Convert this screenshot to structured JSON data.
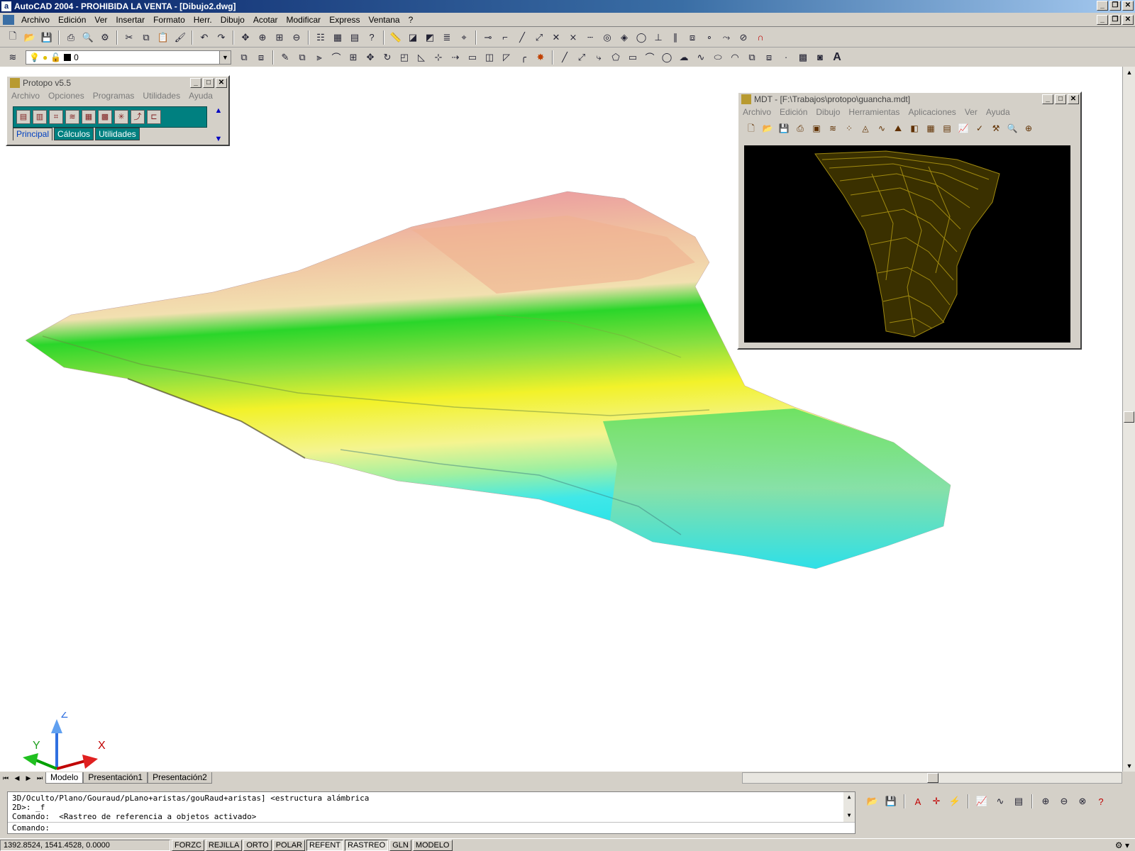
{
  "window": {
    "title": "AutoCAD 2004 - PROHIBIDA LA VENTA - [Dibujo2.dwg]",
    "app_icon": "a"
  },
  "menu": [
    "Archivo",
    "Edición",
    "Ver",
    "Insertar",
    "Formato",
    "Herr.",
    "Dibujo",
    "Acotar",
    "Modificar",
    "Express",
    "Ventana",
    "?"
  ],
  "layer": {
    "current": "0"
  },
  "text_tool": "A",
  "protopo": {
    "title": "Protopo v5.5",
    "menu": [
      "Archivo",
      "Opciones",
      "Programas",
      "Utilidades",
      "Ayuda"
    ],
    "tabs": [
      "Principal",
      "Cálculos",
      "Utilidades"
    ]
  },
  "mdt": {
    "title": "MDT - [F:\\Trabajos\\protopo\\guancha.mdt]",
    "menu": [
      "Archivo",
      "Edición",
      "Dibujo",
      "Herramientas",
      "Aplicaciones",
      "Ver",
      "Ayuda"
    ]
  },
  "ucs": {
    "x": "X",
    "y": "Y",
    "z": "Z"
  },
  "layout_tabs": [
    "Modelo",
    "Presentación1",
    "Presentación2"
  ],
  "command": {
    "history": [
      "3D/Oculto/Plano/Gouraud/pLano+aristas/gouRaud+aristas] <estructura alámbrica",
      "2D>: _f",
      "Comando:  <Rastreo de referencia a objetos activado>"
    ],
    "prompt": "Comando:"
  },
  "status": {
    "coords": "1392.8524, 1541.4528, 0.0000",
    "buttons": [
      {
        "label": "FORZC",
        "on": false
      },
      {
        "label": "REJILLA",
        "on": false
      },
      {
        "label": "ORTO",
        "on": false
      },
      {
        "label": "POLAR",
        "on": false
      },
      {
        "label": "REFENT",
        "on": true
      },
      {
        "label": "RASTREO",
        "on": true
      },
      {
        "label": "GLN",
        "on": false
      },
      {
        "label": "MODELO",
        "on": false
      }
    ]
  },
  "colors": {
    "title_gradient_start": "#0a246a",
    "terrain_top": "#e88890",
    "terrain_mid_green": "#22d022",
    "terrain_yellow": "#f0f020",
    "terrain_cyan": "#20e8e8",
    "mdt_background": "#000000",
    "mdt_lines": "#a08a10"
  }
}
